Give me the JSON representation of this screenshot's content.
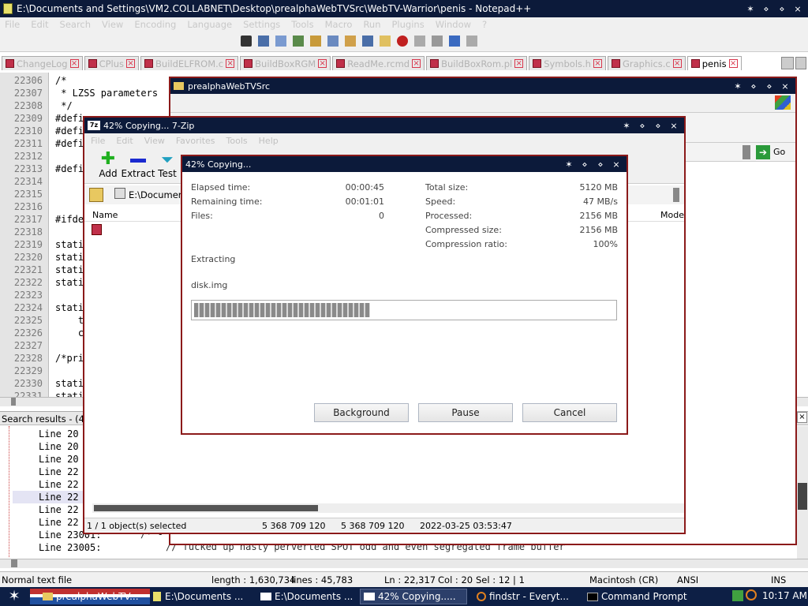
{
  "npp": {
    "title": "E:\\Documents and Settings\\VM2.COLLABNET\\Desktop\\prealphaWebTVSrc\\WebTV-Warrior\\penis - Notepad++",
    "menu": [
      "File",
      "Edit",
      "Search",
      "View",
      "Encoding",
      "Language",
      "Settings",
      "Tools",
      "Macro",
      "Run",
      "Plugins",
      "Window",
      "?"
    ],
    "tabs": [
      "ChangeLog",
      "CPlus",
      "BuildELFROM.c",
      "BuildBoxRGM",
      "ReadMe.rcmd",
      "BuildBoxRom.pl",
      "Symbols.h",
      "Graphics.c",
      "penis"
    ],
    "line_numbers": [
      "22306",
      "22307",
      "22308",
      "22309",
      "22310",
      "22311",
      "22312",
      "22313",
      "22314",
      "22315",
      "22316",
      "22317",
      "22318",
      "22319",
      "22320",
      "22321",
      "22322",
      "22323",
      "22324",
      "22325",
      "22326",
      "22327",
      "22328",
      "22329",
      "22330",
      "22331"
    ],
    "code_lines": [
      "/*",
      " * LZSS parameters",
      " */",
      "#defi",
      "#defi",
      "#defi",
      "",
      "#defi",
      "",
      "",
      "",
      "#ifde",
      "",
      "stati",
      "stati",
      "stati",
      "stati",
      "",
      "stati",
      "    t",
      "    c",
      "",
      "/*pri",
      "",
      "stati",
      "stati"
    ],
    "search_header": "Search results - (40 hi",
    "search_lines": [
      {
        "text": "Line 20",
        "highlight": false
      },
      {
        "text": "Line 20",
        "highlight": false
      },
      {
        "text": "Line 20",
        "highlight": false
      },
      {
        "text": "Line 22",
        "highlight": false
      },
      {
        "text": "Line 22",
        "highlight": false
      },
      {
        "text": "Line 22",
        "highlight": true
      },
      {
        "text": "Line 22",
        "highlight": false
      },
      {
        "text": "Line 22",
        "highlight": false
      },
      {
        "text": "Line 23001:",
        "highlight": false
      },
      {
        "text": "Line 23005:",
        "highlight": false
      }
    ],
    "search_extra_1": "/* -",
    "search_extra_2": "// fucked up nasty perverted SPOT odd and even segregated frame buffer",
    "status": {
      "type": "Normal text file",
      "length": "length : 1,630,734",
      "lines": "lines : 45,783",
      "ln": "Ln : 22,317",
      "col": "Col : 20",
      "sel": "Sel : 12 | 1",
      "eol": "Macintosh (CR)",
      "encoding": "ANSI",
      "mode": "INS"
    }
  },
  "explorer": {
    "title": "prealphaWebTVSrc",
    "go_label": "Go"
  },
  "zip": {
    "title": "42% Copying... 7-Zip",
    "menu": [
      "File",
      "Edit",
      "View",
      "Favorites",
      "Tools",
      "Help"
    ],
    "toolbar": [
      "Add",
      "Extract",
      "Test"
    ],
    "path": "E:\\Documents",
    "col_name": "Name",
    "col_mode": "Mode",
    "status": {
      "selected": "1 / 1 object(s) selected",
      "size1": "5 368 709 120",
      "size2": "5 368 709 120",
      "date": "2022-03-25 03:53:47"
    }
  },
  "dialog": {
    "title": "42% Copying...",
    "left_labels": [
      "Elapsed time:",
      "Remaining time:",
      "Files:"
    ],
    "left_values": [
      "00:00:45",
      "00:01:01",
      "0"
    ],
    "right_labels": [
      "Total size:",
      "Speed:",
      "Processed:",
      "Compressed size:",
      "Compression ratio:"
    ],
    "right_values": [
      "5120 MB",
      "47 MB/s",
      "2156 MB",
      "2156 MB",
      "100%"
    ],
    "action": "Extracting",
    "file": "disk.img",
    "progress": 0.42,
    "buttons": {
      "background": "Background",
      "pause": "Pause",
      "cancel": "Cancel"
    }
  },
  "taskbar": {
    "items": [
      "prealphaWebTV...",
      "E:\\Documents ...",
      "E:\\Documents ...",
      "42% Copying.....",
      "findstr - Everyt...",
      "Command Prompt"
    ],
    "clock": "10:17 AM"
  },
  "colors": {
    "titlebar": "#0c1a3a",
    "taskbar": "#0d1f45",
    "dialog_border": "#8b1a1a",
    "progress_fill": "#8a8a8a"
  }
}
